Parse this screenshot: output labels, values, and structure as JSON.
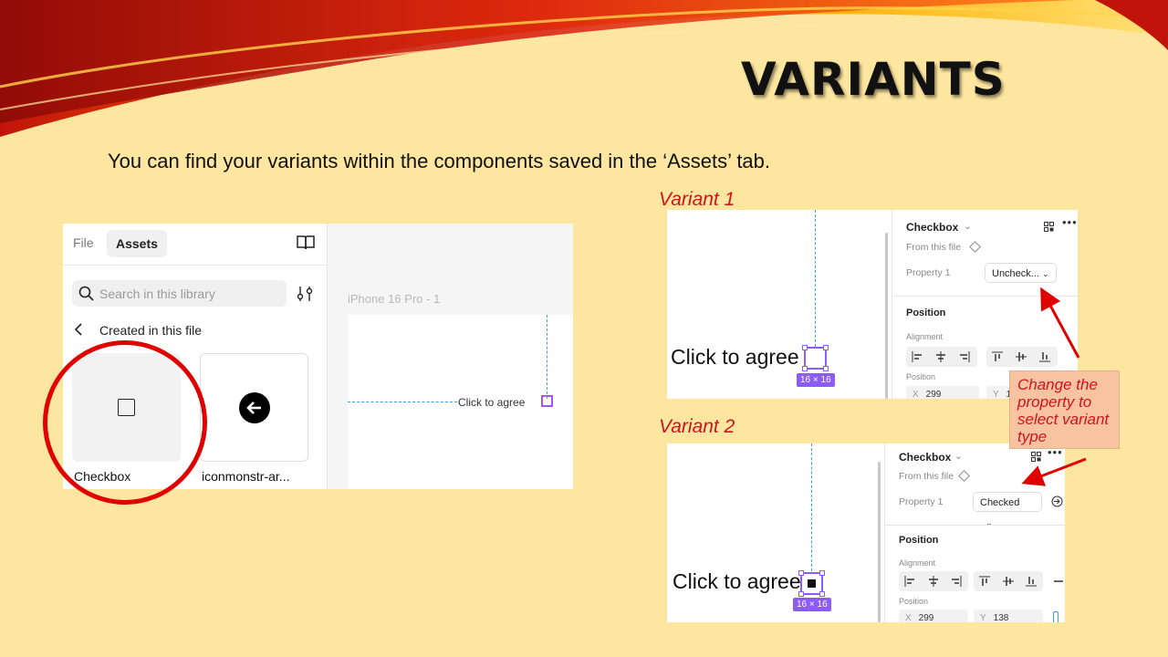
{
  "slide": {
    "title": "VARIANTS",
    "subtitle": "You can find your variants within the components saved in the ‘Assets’ tab."
  },
  "assets_panel": {
    "tabs": [
      "File",
      "Assets"
    ],
    "active_tab": "Assets",
    "search_placeholder": "Search in this library",
    "section_label": "Created in this file",
    "components": [
      {
        "label": "Checkbox",
        "icon": "checkbox-icon"
      },
      {
        "label": "iconmonstr-ar...",
        "icon": "arrow-left-circle-icon"
      }
    ],
    "canvas_frame_label": "iPhone 16 Pro - 1",
    "canvas_text": "Click to agree",
    "icons": {
      "library": "book-icon",
      "search": "search-icon",
      "filter": "sliders-icon",
      "back": "chevron-left-icon"
    }
  },
  "variant1": {
    "caption": "Variant 1",
    "canvas_text": "Click to agree",
    "size_badge": "16 × 16",
    "component_name": "Checkbox",
    "source": "From this file",
    "property_label": "Property 1",
    "property_value": "Uncheck...",
    "section": "Position",
    "alignment_label": "Alignment",
    "position_label": "Position",
    "x_label": "X",
    "x_value": "299",
    "y_label": "Y",
    "y_value": "1:"
  },
  "variant2": {
    "caption": "Variant 2",
    "canvas_text": "Click to agree",
    "size_badge": "16 × 16",
    "component_name": "Checkbox",
    "source": "From this file",
    "property_label": "Property 1",
    "property_value": "Checked",
    "section": "Position",
    "alignment_label": "Alignment",
    "position_label": "Position",
    "x_label": "X",
    "x_value": "299",
    "y_label": "Y",
    "y_value": "138"
  },
  "callout": {
    "text": "Change the property to select variant type"
  },
  "colors": {
    "background": "#fde6a0",
    "highlight": "#e00000",
    "caption": "#d0141c",
    "selection": "#8b5cf6",
    "guide": "#3aa0e6"
  }
}
